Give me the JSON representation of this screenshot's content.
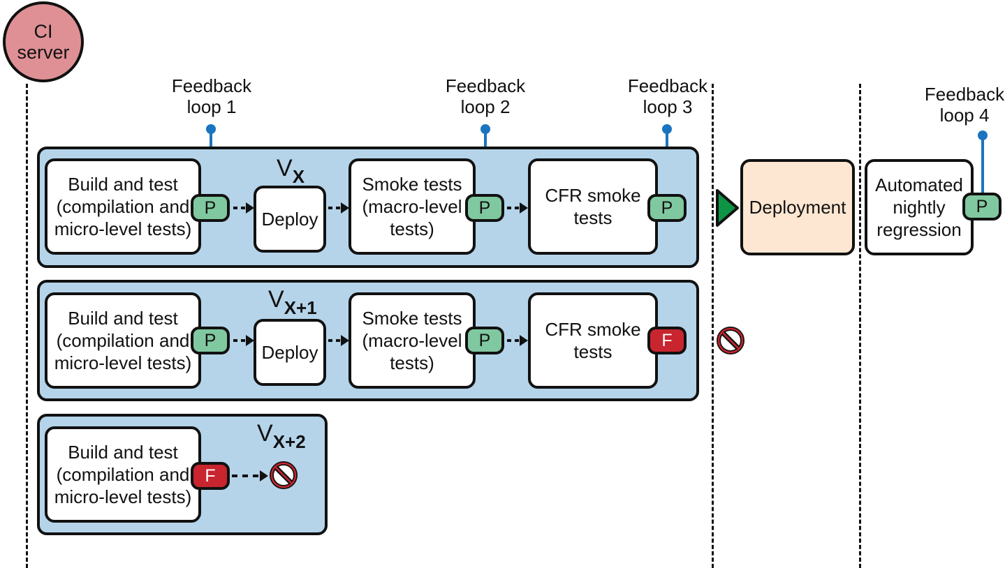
{
  "ci_server": {
    "label_line1": "CI",
    "label_line2": "server",
    "color": "#df9095"
  },
  "feedback_loops": [
    {
      "line1": "Feedback",
      "line2": "loop 1"
    },
    {
      "line1": "Feedback",
      "line2": "loop 2"
    },
    {
      "line1": "Feedback",
      "line2": "loop 3"
    },
    {
      "line1": "Feedback",
      "line2": "loop 4"
    }
  ],
  "versions": [
    {
      "name": "V",
      "subscript": "X",
      "stages": [
        {
          "line1": "Build and test",
          "line2": "(compilation and",
          "line3": "micro-level tests)",
          "result": "P"
        },
        {
          "line1": "Deploy"
        },
        {
          "line1": "Smoke tests",
          "line2": "(macro-level",
          "line3": "tests)",
          "result": "P"
        },
        {
          "line1": "CFR smoke",
          "line2": "tests",
          "result": "P"
        }
      ]
    },
    {
      "name": "V",
      "subscript": "X+1",
      "stages": [
        {
          "line1": "Build and test",
          "line2": "(compilation and",
          "line3": "micro-level tests)",
          "result": "P"
        },
        {
          "line1": "Deploy"
        },
        {
          "line1": "Smoke tests",
          "line2": "(macro-level",
          "line3": "tests)",
          "result": "P"
        },
        {
          "line1": "CFR smoke",
          "line2": "tests",
          "result": "F"
        }
      ]
    },
    {
      "name": "V",
      "subscript": "X+2",
      "stages": [
        {
          "line1": "Build and test",
          "line2": "(compilation and",
          "line3": "micro-level tests)",
          "result": "F"
        }
      ]
    }
  ],
  "deployment": {
    "label": "Deployment",
    "color": "#fde7d2"
  },
  "nightly": {
    "line1": "Automated",
    "line2": "nightly",
    "line3": "regression",
    "result": "P"
  },
  "colors": {
    "pass": "#80c8a0",
    "fail": "#c8252f",
    "panel": "#b5d4ea",
    "feedback": "#1a74bf",
    "go": "#0d9444"
  }
}
